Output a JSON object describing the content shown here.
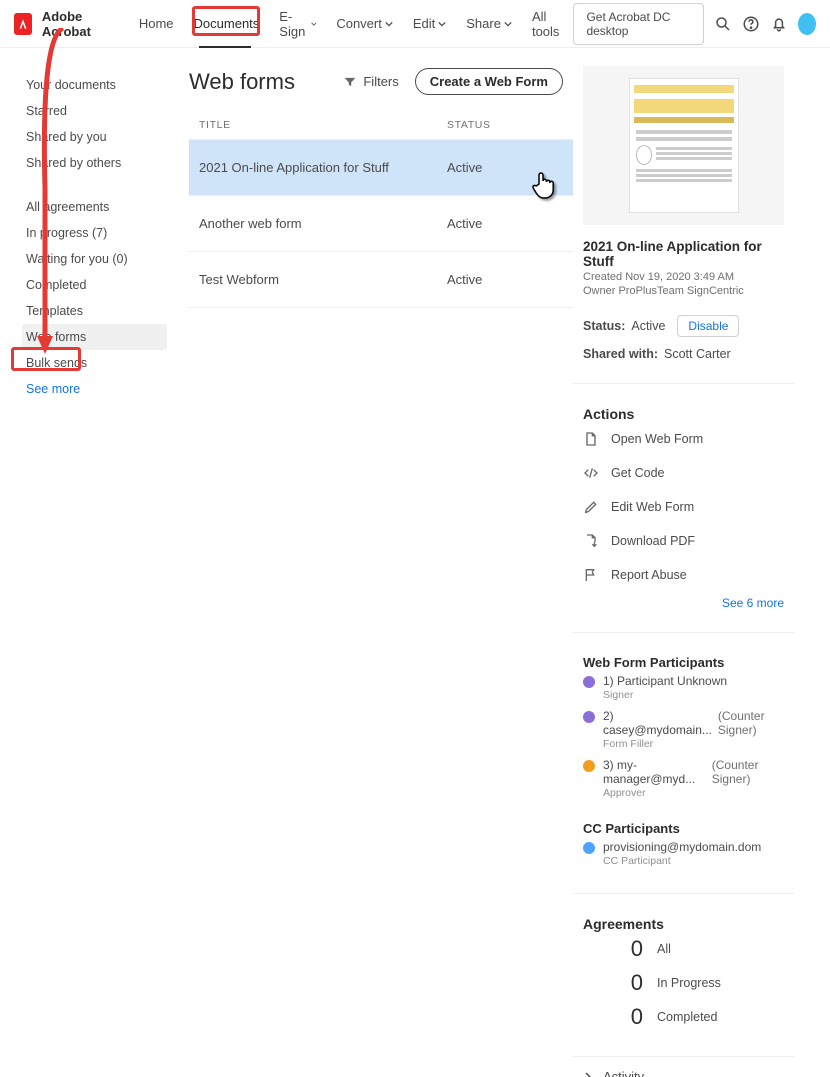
{
  "brand": "Adobe Acrobat",
  "nav": {
    "home": "Home",
    "documents": "Documents",
    "esign": "E-Sign",
    "convert": "Convert",
    "edit": "Edit",
    "share": "Share",
    "alltools": "All tools"
  },
  "cta": "Get Acrobat DC desktop",
  "sidebar": {
    "group1": {
      "yourdocs": "Your documents",
      "starred": "Starred",
      "shared_by_you": "Shared by you",
      "shared_by_others": "Shared by others"
    },
    "group2": {
      "all_agreements": "All agreements",
      "in_progress": "In progress (7)",
      "waiting": "Waiting for you (0)",
      "completed": "Completed",
      "templates": "Templates",
      "web_forms": "Web forms",
      "bulk_sends": "Bulk sends"
    },
    "see_more": "See more"
  },
  "main": {
    "title": "Web forms",
    "filters": "Filters",
    "create": "Create a Web Form",
    "col_title": "TITLE",
    "col_status": "STATUS",
    "rows": [
      {
        "title": "2021 On-line Application for Stuff",
        "status": "Active"
      },
      {
        "title": "Another web form",
        "status": "Active"
      },
      {
        "title": "Test Webform",
        "status": "Active"
      }
    ]
  },
  "detail": {
    "title": "2021 On-line Application for Stuff",
    "created": "Created Nov 19, 2020 3:49 AM",
    "owner": "Owner ProPlusTeam SignCentric",
    "status_label": "Status:",
    "status_value": "Active",
    "disable": "Disable",
    "shared_label": "Shared with:",
    "shared_value": "Scott Carter",
    "actions_hdr": "Actions",
    "actions": {
      "open": "Open Web Form",
      "getcode": "Get Code",
      "edit": "Edit Web Form",
      "download": "Download PDF",
      "report": "Report Abuse"
    },
    "see_more": "See 6 more",
    "participants_hdr": "Web Form Participants",
    "participants": [
      {
        "label": "1) Participant Unknown",
        "role": "",
        "sub": "Signer",
        "color": "#8b6fd8"
      },
      {
        "label": "2) casey@mydomain...",
        "role": "(Counter Signer)",
        "sub": "Form Filler",
        "color": "#8b6fd8"
      },
      {
        "label": "3) my-manager@myd...",
        "role": "(Counter Signer)",
        "sub": "Approver",
        "color": "#f29d1f"
      }
    ],
    "cc_hdr": "CC Participants",
    "cc": {
      "label": "provisioning@mydomain.dom",
      "sub": "CC Participant",
      "color": "#4da3ff"
    },
    "agreements_hdr": "Agreements",
    "agreements": [
      {
        "n": "0",
        "label": "All"
      },
      {
        "n": "0",
        "label": "In Progress"
      },
      {
        "n": "0",
        "label": "Completed"
      }
    ],
    "activity": "Activity"
  }
}
